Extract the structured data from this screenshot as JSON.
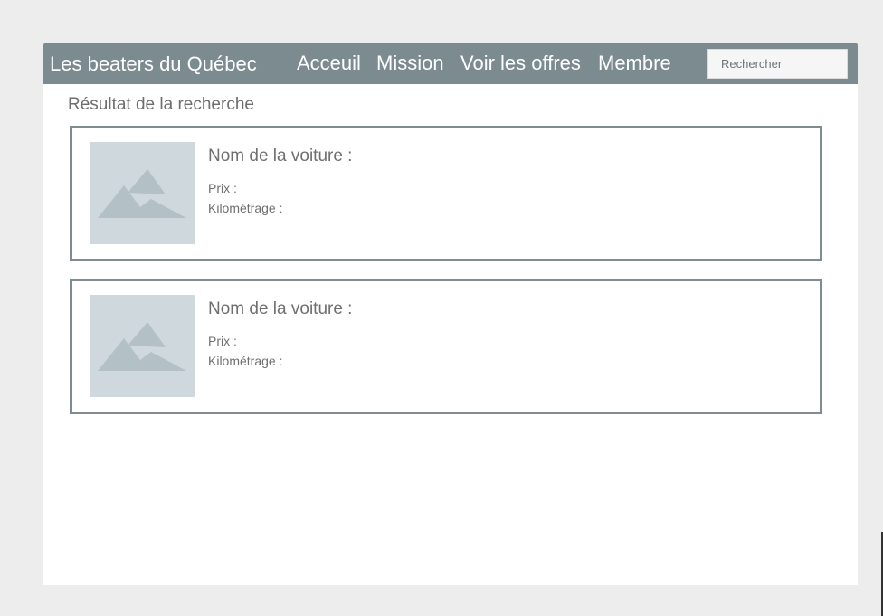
{
  "header": {
    "brand": "Les beaters du Québec",
    "nav": [
      "Acceuil",
      "Mission",
      "Voir les offres",
      "Membre"
    ],
    "search": {
      "placeholder": "Rechercher",
      "value": ""
    }
  },
  "main": {
    "title": "Résultat de la recherche",
    "results": [
      {
        "name_label": "Nom de la voiture :",
        "price_label": "Prix :",
        "mileage_label": "Kilométrage :",
        "image": "image-placeholder-icon"
      },
      {
        "name_label": "Nom de la voiture :",
        "price_label": "Prix :",
        "mileage_label": "Kilométrage :",
        "image": "image-placeholder-icon"
      }
    ]
  },
  "colors": {
    "navbar": "#7b8b90",
    "card_border": "#7f8d92",
    "placeholder_bg": "#cfd8dd",
    "placeholder_fg": "#b3c0c6",
    "page_bg": "#ededed"
  }
}
